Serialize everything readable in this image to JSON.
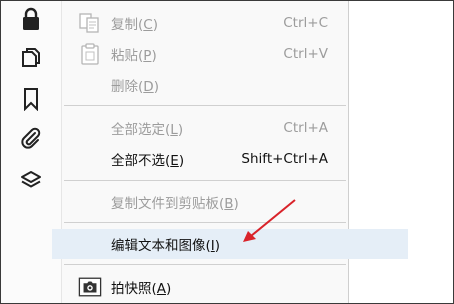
{
  "sidebar": {
    "icons": [
      "lock-icon",
      "pages-icon",
      "bookmark-icon",
      "attachment-icon",
      "layers-icon"
    ]
  },
  "menu": {
    "copy": {
      "label": "复制(C)",
      "shortcut": "Ctrl+C"
    },
    "paste": {
      "label": "粘贴(P)",
      "shortcut": "Ctrl+V"
    },
    "delete": {
      "label": "删除(D)"
    },
    "select_all": {
      "label": "全部选定(L)",
      "shortcut": "Ctrl+A"
    },
    "deselect_all": {
      "label": "全部不选(E)",
      "shortcut": "Shift+Ctrl+A"
    },
    "copy_file_clipboard": {
      "label": "复制文件到剪贴板(B)"
    },
    "edit_text_images": {
      "label": "编辑文本和图像(I)"
    },
    "snapshot": {
      "label": "拍快照(A)"
    }
  },
  "colors": {
    "highlight": "#e5eef7",
    "disabled_text": "#9c9c9c",
    "annotation_arrow": "#d9232a"
  }
}
